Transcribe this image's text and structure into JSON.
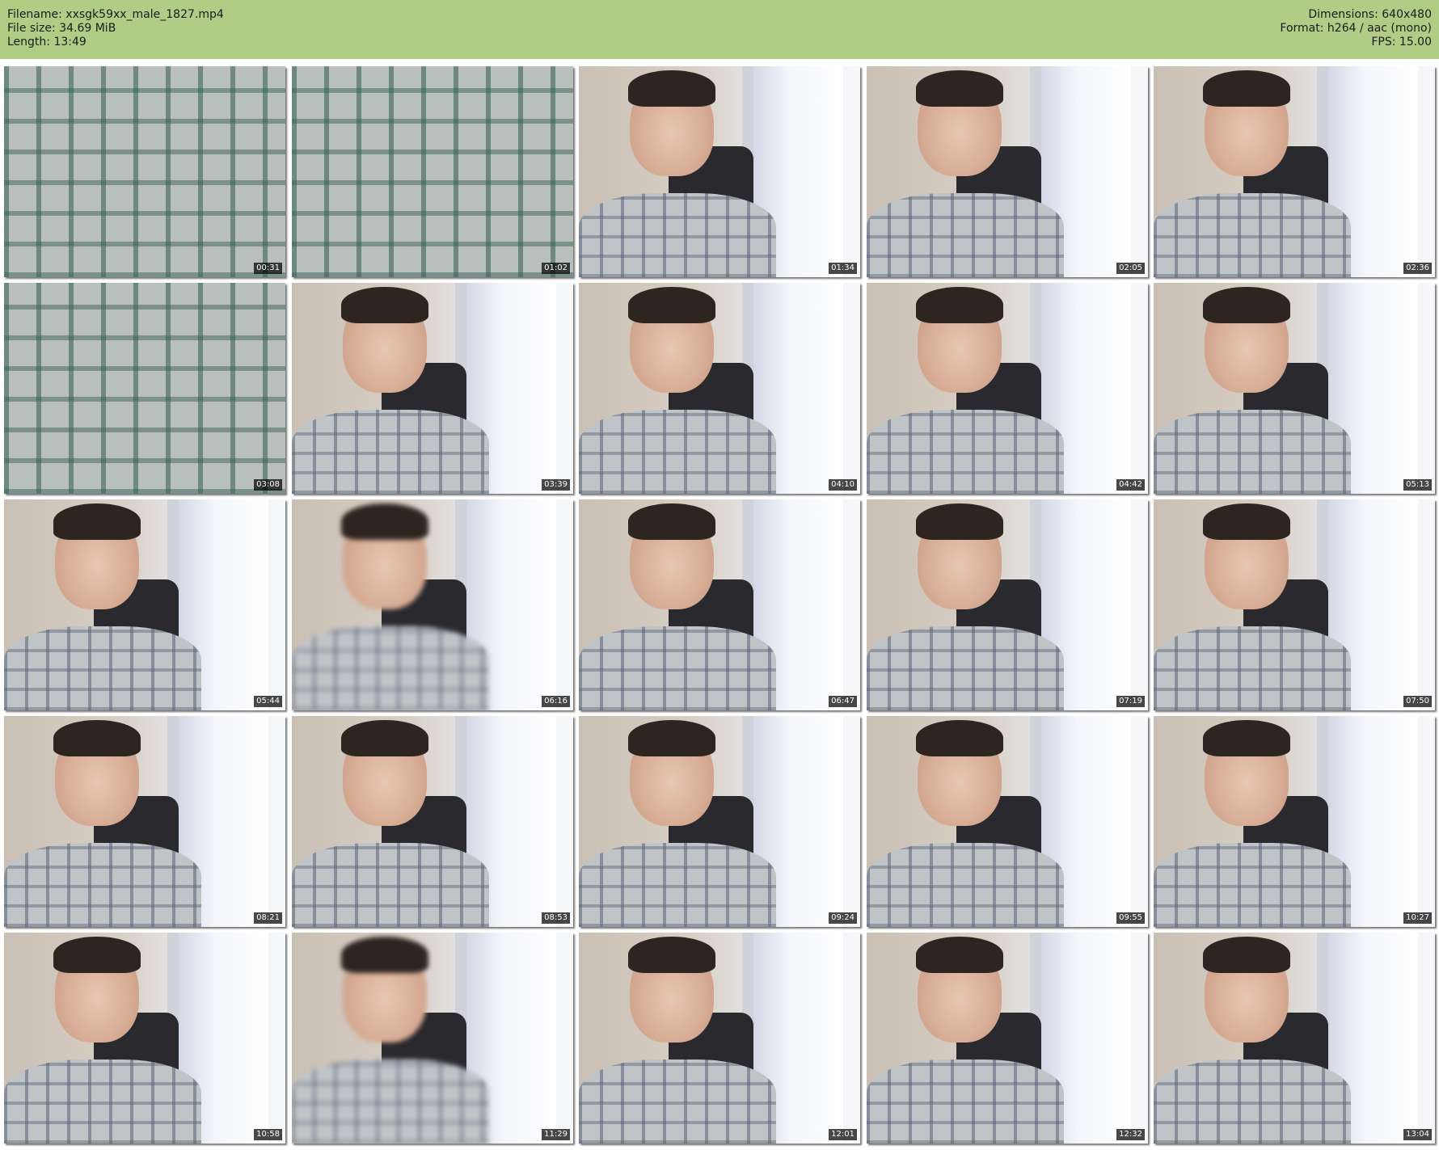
{
  "header": {
    "filename_line": "Filename: xxsgk59xx_male_1827.mp4",
    "filesize_line": "File size: 34.69 MiB",
    "length_line": "Length: 13:49",
    "dimensions_line": "Dimensions: 640x480",
    "format_line": "Format: h264 / aac (mono)",
    "fps_line": "FPS: 15.00",
    "background_color": "#b1cc85"
  },
  "thumbnails": [
    {
      "timestamp": "00:31",
      "scene": "closeup"
    },
    {
      "timestamp": "01:02",
      "scene": "closeup"
    },
    {
      "timestamp": "01:34",
      "scene": "face"
    },
    {
      "timestamp": "02:05",
      "scene": "face"
    },
    {
      "timestamp": "02:36",
      "scene": "face"
    },
    {
      "timestamp": "03:08",
      "scene": "closeup"
    },
    {
      "timestamp": "03:39",
      "scene": "face"
    },
    {
      "timestamp": "04:10",
      "scene": "face"
    },
    {
      "timestamp": "04:42",
      "scene": "face"
    },
    {
      "timestamp": "05:13",
      "scene": "face"
    },
    {
      "timestamp": "05:44",
      "scene": "face"
    },
    {
      "timestamp": "06:16",
      "scene": "blur"
    },
    {
      "timestamp": "06:47",
      "scene": "face"
    },
    {
      "timestamp": "07:19",
      "scene": "face"
    },
    {
      "timestamp": "07:50",
      "scene": "face"
    },
    {
      "timestamp": "08:21",
      "scene": "face"
    },
    {
      "timestamp": "08:53",
      "scene": "face"
    },
    {
      "timestamp": "09:24",
      "scene": "face"
    },
    {
      "timestamp": "09:55",
      "scene": "face"
    },
    {
      "timestamp": "10:27",
      "scene": "face"
    },
    {
      "timestamp": "10:58",
      "scene": "face"
    },
    {
      "timestamp": "11:29",
      "scene": "blur"
    },
    {
      "timestamp": "12:01",
      "scene": "face"
    },
    {
      "timestamp": "12:32",
      "scene": "face"
    },
    {
      "timestamp": "13:04",
      "scene": "face"
    }
  ]
}
